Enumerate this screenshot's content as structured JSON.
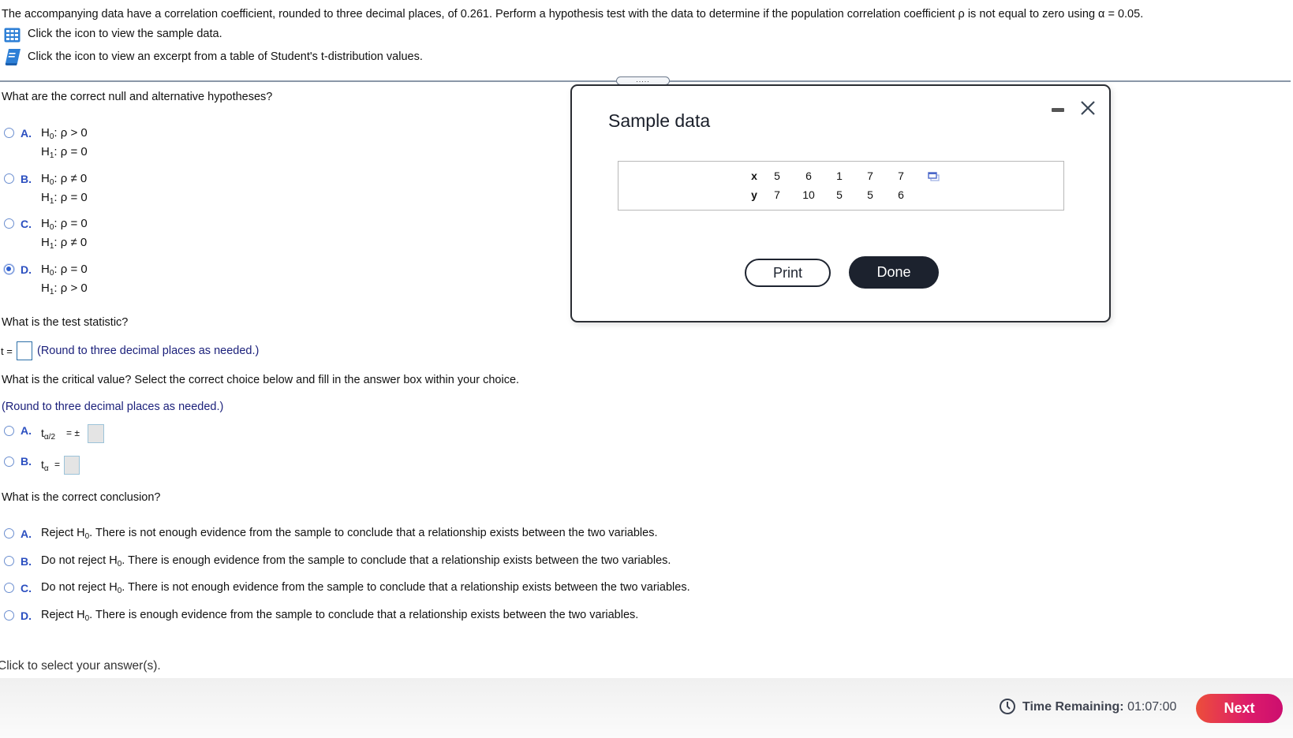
{
  "header": {
    "intro": "The accompanying data have a correlation coefficient, rounded to three decimal places, of 0.261. Perform a hypothesis test with the data to determine if the population correlation coefficient ρ is not equal to zero using α = 0.05.",
    "links": [
      {
        "icon": "table-grid-icon",
        "label": "Click the icon to view the sample data."
      },
      {
        "icon": "book-icon",
        "label": "Click the icon to view an excerpt from a table of Student's t-distribution values."
      }
    ],
    "drag_handle": "....."
  },
  "q1": {
    "prompt": "What are the correct null and alternative hypotheses?",
    "selected": "D",
    "options": [
      {
        "letter": "A.",
        "h0": "ρ > 0",
        "h1": "ρ = 0"
      },
      {
        "letter": "B.",
        "h0": "ρ ≠ 0",
        "h1": "ρ = 0"
      },
      {
        "letter": "C.",
        "h0": "ρ = 0",
        "h1": "ρ ≠ 0"
      },
      {
        "letter": "D.",
        "h0": "ρ = 0",
        "h1": "ρ > 0"
      }
    ],
    "h0_label": "H",
    "h0_sub": "0",
    "h1_label": "H",
    "h1_sub": "1"
  },
  "q2": {
    "prompt": "What is the test statistic?",
    "prefix": "t =",
    "value": "",
    "note": "(Round to three decimal places as needed.)"
  },
  "q3": {
    "prompt": "What is the critical value? Select the correct choice below and fill in the answer box within your choice.",
    "note": "(Round to three decimal places as needed.)",
    "options": [
      {
        "letter": "A.",
        "base": "t",
        "sub": "α/2",
        "rel": "= ±",
        "value": ""
      },
      {
        "letter": "B.",
        "base": "t",
        "sub": "α",
        "rel": "=",
        "value": ""
      }
    ]
  },
  "q4": {
    "prompt": "What is the correct conclusion?",
    "options": [
      {
        "letter": "A.",
        "pre": "Reject H",
        "sub": "0",
        "post": ". There is not enough evidence from the sample to conclude that a relationship exists between the two variables."
      },
      {
        "letter": "B.",
        "pre": "Do not reject H",
        "sub": "0",
        "post": ". There is enough evidence from the sample to conclude that a relationship exists between the two variables."
      },
      {
        "letter": "C.",
        "pre": "Do not reject H",
        "sub": "0",
        "post": ". There is not enough evidence from the sample to conclude that a relationship exists between the two variables."
      },
      {
        "letter": "D.",
        "pre": "Reject H",
        "sub": "0",
        "post": ". There is enough evidence from the sample to conclude that a relationship exists between the two variables."
      }
    ]
  },
  "status_hint": "Click to select your answer(s).",
  "dialog": {
    "title": "Sample data",
    "table": {
      "rows": [
        {
          "label": "x",
          "values": [
            "5",
            "6",
            "1",
            "7",
            "7"
          ]
        },
        {
          "label": "y",
          "values": [
            "7",
            "10",
            "5",
            "5",
            "6"
          ]
        }
      ]
    },
    "print_label": "Print",
    "done_label": "Done"
  },
  "footer": {
    "time_label": "Time Remaining:",
    "time_value": "01:07:00",
    "next_label": "Next",
    "next_color_start": "#ec4e3b",
    "next_color_end": "#cc0e6f"
  }
}
